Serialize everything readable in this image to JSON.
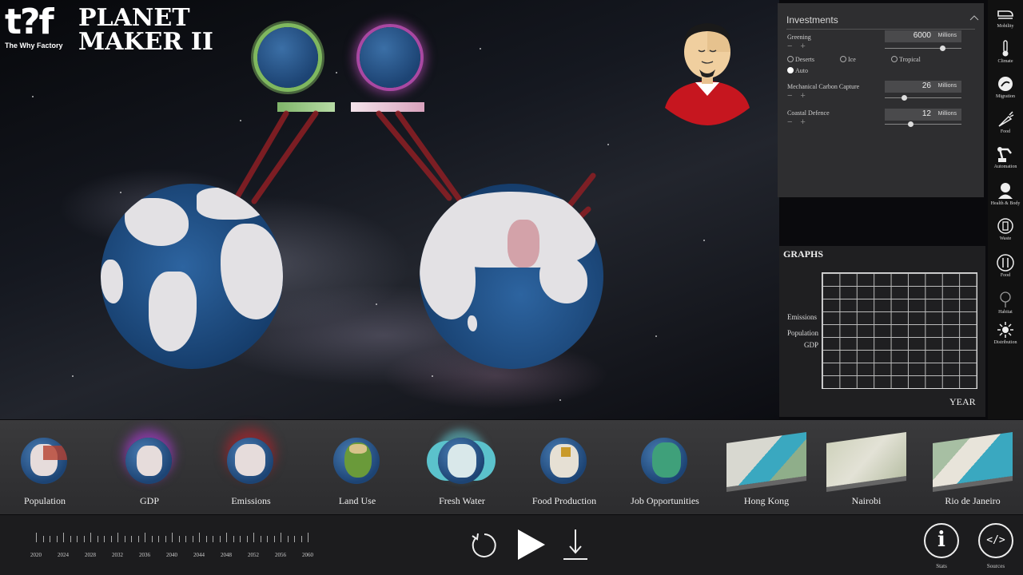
{
  "logo": {
    "mark": "t?f",
    "subtitle": "The Why Factory"
  },
  "app_title": {
    "line1": "PLANET",
    "line2": "MAKER II"
  },
  "investments": {
    "title": "Investments",
    "greening": {
      "label": "Greening",
      "value": "6000",
      "unit": "Millions",
      "level": 0.75
    },
    "greening_options": [
      "Deserts",
      "Ice",
      "Tropical",
      "Auto"
    ],
    "greening_selected": "Auto",
    "carbon": {
      "label": "Mechanical Carbon Capture",
      "value": "26",
      "unit": "Millions",
      "level": 0.25
    },
    "coastal": {
      "label": "Coastal Defence",
      "value": "12",
      "unit": "Millions",
      "level": 0.33
    }
  },
  "sidebar": {
    "items": [
      {
        "label": "Mobility",
        "icon": "train-icon"
      },
      {
        "label": "Climate",
        "icon": "thermometer-icon"
      },
      {
        "label": "Migration",
        "icon": "migration-icon"
      },
      {
        "label": "Food",
        "icon": "carrot-icon"
      },
      {
        "label": "Automation",
        "icon": "robot-arm-icon"
      },
      {
        "label": "Health & Body",
        "icon": "person-icon"
      },
      {
        "label": "Waste",
        "icon": "waste-icon"
      },
      {
        "label": "Food",
        "icon": "cutlery-icon"
      },
      {
        "label": "Habitat",
        "icon": "tree-icon"
      },
      {
        "label": "Distribution",
        "icon": "network-icon"
      }
    ]
  },
  "graphs": {
    "title": "GRAPHS",
    "labels": [
      "Emissions",
      "Population",
      "GDP"
    ],
    "x_label": "YEAR"
  },
  "layers": [
    {
      "label": "Population",
      "kind": "globe",
      "color": "#b5402e"
    },
    {
      "label": "GDP",
      "kind": "globe",
      "color": "#a23cc7"
    },
    {
      "label": "Emissions",
      "kind": "globe",
      "color": "#b8222c"
    },
    {
      "label": "Land Use",
      "kind": "globe",
      "color": "#6a9a3a"
    },
    {
      "label": "Fresh Water",
      "kind": "globe",
      "color": "#5bc2cc"
    },
    {
      "label": "Food Production",
      "kind": "globe",
      "color": "#c99a2a"
    },
    {
      "label": "Job Opportunities",
      "kind": "globe",
      "color": "#3fa07a"
    },
    {
      "label": "Hong Kong",
      "kind": "city",
      "color": "#9fb6a0"
    },
    {
      "label": "Nairobi",
      "kind": "city",
      "color": "#b9c0a6"
    },
    {
      "label": "Rio de Janeiro",
      "kind": "city",
      "color": "#a7bfa3"
    }
  ],
  "timeline": {
    "years": [
      "2020",
      "2024",
      "2028",
      "2032",
      "2036",
      "2040",
      "2044",
      "2048",
      "2052",
      "2056",
      "2060"
    ]
  },
  "controls": {
    "reset_icon": "reset-icon",
    "play_icon": "play-icon",
    "download_icon": "download-icon"
  },
  "stats": {
    "label": "Stats",
    "icon_glyph": "i"
  },
  "sources": {
    "label": "Sources",
    "icon_glyph": "</>"
  },
  "colors": {
    "greening_bar": "#8fc37a",
    "gdp_bar": "#e3a9c4",
    "arrow": "#8e1f24",
    "ocean": "#1f4f86"
  }
}
